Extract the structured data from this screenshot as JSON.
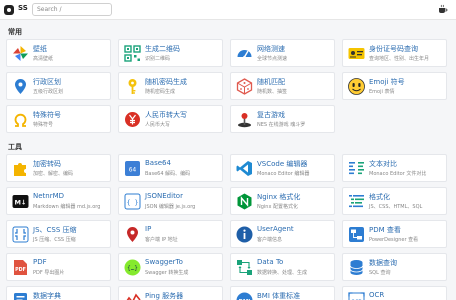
{
  "header": {
    "brand": "SS",
    "search_placeholder": "Search /"
  },
  "sections": [
    {
      "title": "常用",
      "items": [
        {
          "title": "壁纸",
          "desc": "高清壁纸",
          "icon": "pinwheel-icon"
        },
        {
          "title": "生成二维码",
          "desc": "识别二维码",
          "icon": "qrcode-icon"
        },
        {
          "title": "网络测速",
          "desc": "全球节点测速",
          "icon": "speedometer-icon"
        },
        {
          "title": "身份证号码查询",
          "desc": "查询地区、性别、出生年月",
          "icon": "id-card-icon"
        },
        {
          "title": "行政区划",
          "desc": "五级行政区划",
          "icon": "location-pin-icon"
        },
        {
          "title": "随机密码生成",
          "desc": "随机密码生成",
          "icon": "key-icon"
        },
        {
          "title": "随机匹配",
          "desc": "随机数、抽签",
          "icon": "dice-icon"
        },
        {
          "title": "Emoji 符号",
          "desc": "Emoji 表情",
          "icon": "emoji-icon"
        },
        {
          "title": "特殊符号",
          "desc": "特殊符号",
          "icon": "omega-icon"
        },
        {
          "title": "人民币转大写",
          "desc": "人民币大写",
          "icon": "yuan-icon"
        },
        {
          "title": "复古游戏",
          "desc": "NES 在线游戏 魂斗罗",
          "icon": "joystick-icon"
        }
      ]
    },
    {
      "title": "工具",
      "items": [
        {
          "title": "加密转码",
          "desc": "加密、解密、编码",
          "icon": "puzzle-icon"
        },
        {
          "title": "Base64",
          "desc": "Base64 解码、编码",
          "icon": "base64-icon"
        },
        {
          "title": "VSCode 编辑器",
          "desc": "Monaco Editor 编辑器",
          "icon": "vscode-icon"
        },
        {
          "title": "文本对比",
          "desc": "Monaco Editor 文件对比",
          "icon": "diff-icon"
        },
        {
          "title": "NetnrMD",
          "desc": "Markdown 编辑器 md.js.org",
          "icon": "markdown-icon"
        },
        {
          "title": "JSONEditor",
          "desc": "JSON 编辑器 je.js.org",
          "icon": "json-icon"
        },
        {
          "title": "Nginx 格式化",
          "desc": "Nginx 配置格式化",
          "icon": "nginx-icon"
        },
        {
          "title": "格式化",
          "desc": "JS、CSS、HTML、SQL",
          "icon": "format-icon"
        },
        {
          "title": "JS、CSS 压缩",
          "desc": "JS 压缩、CSS 压缩",
          "icon": "compress-icon"
        },
        {
          "title": "IP",
          "desc": "客户端 IP 地址",
          "icon": "ip-pin-icon"
        },
        {
          "title": "UserAgent",
          "desc": "客户端信息",
          "icon": "info-icon"
        },
        {
          "title": "PDM 查看",
          "desc": "PowerDesigner 查看",
          "icon": "pdm-icon"
        },
        {
          "title": "PDF",
          "desc": "PDF 导出图片",
          "icon": "pdf-icon"
        },
        {
          "title": "SwaggerTo",
          "desc": "Swagger 转换生成",
          "icon": "swagger-icon"
        },
        {
          "title": "Data To",
          "desc": "数据转换、处理、生成",
          "icon": "data-to-icon"
        },
        {
          "title": "数据查询",
          "desc": "SQL 查询",
          "icon": "database-icon"
        },
        {
          "title": "数据字典",
          "desc": "数据字典",
          "icon": "dictionary-icon"
        },
        {
          "title": "Ping 服务器",
          "desc": "Ping 对象存储",
          "icon": "ping-icon"
        },
        {
          "title": "BMI 体重标准",
          "desc": "中国成人超重和肥胖标准",
          "icon": "bmi-icon"
        },
        {
          "title": "OCR",
          "desc": "识别图片内容",
          "icon": "ocr-icon"
        }
      ]
    }
  ]
}
